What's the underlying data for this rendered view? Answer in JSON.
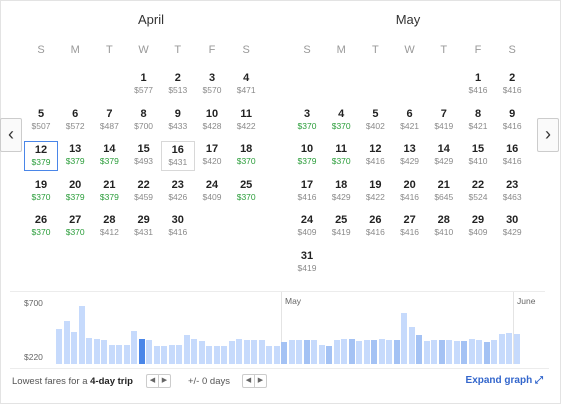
{
  "nav": {
    "prev_icon": "‹",
    "next_icon": "›"
  },
  "april": {
    "title": "April",
    "dow": [
      "S",
      "M",
      "T",
      "W",
      "T",
      "F",
      "S"
    ],
    "rows": [
      [
        null,
        null,
        null,
        {
          "d": "1",
          "p": "$577"
        },
        {
          "d": "2",
          "p": "$513"
        },
        {
          "d": "3",
          "p": "$570"
        },
        {
          "d": "4",
          "p": "$471"
        }
      ],
      [
        {
          "d": "5",
          "p": "$507"
        },
        {
          "d": "6",
          "p": "$572"
        },
        {
          "d": "7",
          "p": "$487"
        },
        {
          "d": "8",
          "p": "$700"
        },
        {
          "d": "9",
          "p": "$433"
        },
        {
          "d": "10",
          "p": "$428"
        },
        {
          "d": "11",
          "p": "$422"
        }
      ],
      [
        {
          "d": "12",
          "p": "$379",
          "low": true,
          "sel": true
        },
        {
          "d": "13",
          "p": "$379",
          "low": true
        },
        {
          "d": "14",
          "p": "$379",
          "low": true
        },
        {
          "d": "15",
          "p": "$493"
        },
        {
          "d": "16",
          "p": "$431",
          "hover": true
        },
        {
          "d": "17",
          "p": "$420"
        },
        {
          "d": "18",
          "p": "$370",
          "low": true
        }
      ],
      [
        {
          "d": "19",
          "p": "$370",
          "low": true
        },
        {
          "d": "20",
          "p": "$379",
          "low": true
        },
        {
          "d": "21",
          "p": "$379",
          "low": true
        },
        {
          "d": "22",
          "p": "$459"
        },
        {
          "d": "23",
          "p": "$426"
        },
        {
          "d": "24",
          "p": "$409"
        },
        {
          "d": "25",
          "p": "$370",
          "low": true
        }
      ],
      [
        {
          "d": "26",
          "p": "$370",
          "low": true
        },
        {
          "d": "27",
          "p": "$370",
          "low": true
        },
        {
          "d": "28",
          "p": "$412"
        },
        {
          "d": "29",
          "p": "$431"
        },
        {
          "d": "30",
          "p": "$416"
        },
        null,
        null
      ]
    ]
  },
  "may": {
    "title": "May",
    "dow": [
      "S",
      "M",
      "T",
      "W",
      "T",
      "F",
      "S"
    ],
    "rows": [
      [
        null,
        null,
        null,
        null,
        null,
        {
          "d": "1",
          "p": "$416"
        },
        {
          "d": "2",
          "p": "$416"
        }
      ],
      [
        {
          "d": "3",
          "p": "$370",
          "low": true
        },
        {
          "d": "4",
          "p": "$370",
          "low": true
        },
        {
          "d": "5",
          "p": "$402"
        },
        {
          "d": "6",
          "p": "$421"
        },
        {
          "d": "7",
          "p": "$419"
        },
        {
          "d": "8",
          "p": "$421"
        },
        {
          "d": "9",
          "p": "$416"
        }
      ],
      [
        {
          "d": "10",
          "p": "$379",
          "low": true
        },
        {
          "d": "11",
          "p": "$370",
          "low": true
        },
        {
          "d": "12",
          "p": "$416"
        },
        {
          "d": "13",
          "p": "$429"
        },
        {
          "d": "14",
          "p": "$429"
        },
        {
          "d": "15",
          "p": "$410"
        },
        {
          "d": "16",
          "p": "$416"
        }
      ],
      [
        {
          "d": "17",
          "p": "$416"
        },
        {
          "d": "18",
          "p": "$429"
        },
        {
          "d": "19",
          "p": "$422"
        },
        {
          "d": "20",
          "p": "$416"
        },
        {
          "d": "21",
          "p": "$645"
        },
        {
          "d": "22",
          "p": "$524"
        },
        {
          "d": "23",
          "p": "$463"
        }
      ],
      [
        {
          "d": "24",
          "p": "$409"
        },
        {
          "d": "25",
          "p": "$419"
        },
        {
          "d": "26",
          "p": "$416"
        },
        {
          "d": "27",
          "p": "$416"
        },
        {
          "d": "28",
          "p": "$410"
        },
        {
          "d": "29",
          "p": "$409"
        },
        {
          "d": "30",
          "p": "$429"
        }
      ],
      [
        {
          "d": "31",
          "p": "$419"
        },
        null,
        null,
        null,
        null,
        null,
        null
      ]
    ]
  },
  "graph": {
    "y_max_label": "$700",
    "y_min_label": "$220",
    "month_labels": [
      "May",
      "June"
    ],
    "ylim": [
      220,
      700
    ],
    "selected_index": 11,
    "values": [
      507,
      572,
      487,
      700,
      433,
      428,
      422,
      379,
      379,
      379,
      493,
      431,
      420,
      370,
      370,
      379,
      379,
      459,
      426,
      409,
      370,
      370,
      370,
      412,
      431,
      416,
      416,
      416,
      370,
      370,
      402,
      421,
      419,
      421,
      416,
      379,
      370,
      416,
      429,
      429,
      410,
      416,
      416,
      429,
      422,
      416,
      645,
      524,
      463,
      409,
      419,
      416,
      416,
      410,
      409,
      429,
      419,
      402,
      420,
      470,
      480,
      470
    ]
  },
  "footer": {
    "trip_prefix": "Lowest fares for a ",
    "trip_length": "4-day trip",
    "flex_label": "+/- 0 days",
    "expand_label": "Expand graph",
    "stepper_left": "◀",
    "stepper_right": "▶",
    "expand_icon": "⤢"
  }
}
